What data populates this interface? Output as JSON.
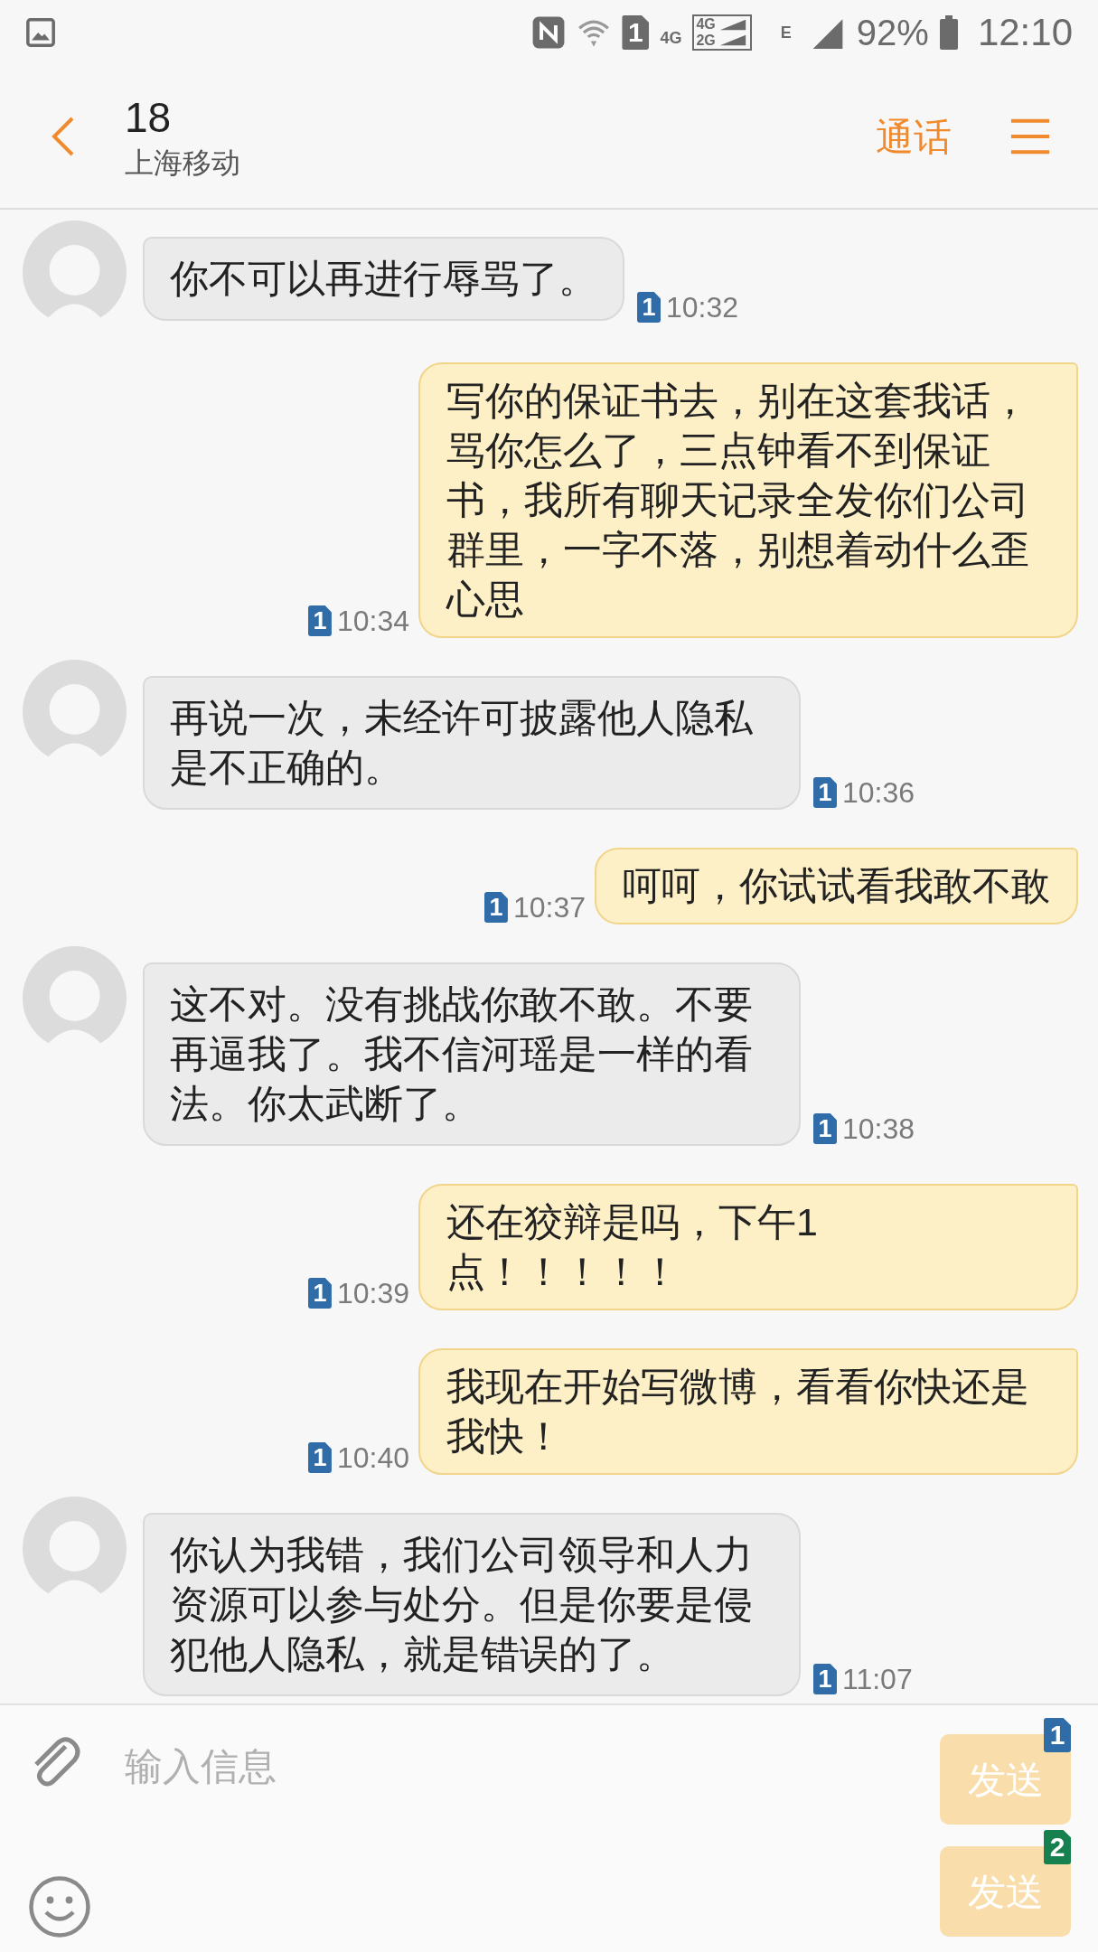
{
  "status_bar": {
    "sim": "1",
    "network": "4G",
    "dual_network": [
      "4G",
      "2G"
    ],
    "edge": "E",
    "battery": "92%",
    "time": "12:10"
  },
  "header": {
    "title": "18",
    "subtitle": "上海移动",
    "call_button": "通话"
  },
  "messages": [
    {
      "kind": "received",
      "text": "你不可以再进行辱骂了。",
      "sim": "1",
      "time": "10:32"
    },
    {
      "kind": "sent",
      "text": "写你的保证书去，别在这套我话，骂你怎么了，三点钟看不到保证书，我所有聊天记录全发你们公司群里，一字不落，别想着动什么歪心思",
      "sim": "1",
      "time": "10:34"
    },
    {
      "kind": "received",
      "text": "再说一次，未经许可披露他人隐私是不正确的。",
      "sim": "1",
      "time": "10:36"
    },
    {
      "kind": "sent",
      "text": "呵呵，你试试看我敢不敢",
      "sim": "1",
      "time": "10:37"
    },
    {
      "kind": "received",
      "text": "这不对。没有挑战你敢不敢。不要再逼我了。我不信河瑶是一样的看法。你太武断了。",
      "sim": "1",
      "time": "10:38"
    },
    {
      "kind": "sent",
      "text": "还在狡辩是吗，下午1点！！！！！",
      "sim": "1",
      "time": "10:39"
    },
    {
      "kind": "sent",
      "text": "我现在开始写微博，看看你快还是我快！",
      "sim": "1",
      "time": "10:40"
    },
    {
      "kind": "received",
      "text": "你认为我错，我们公司领导和人力资源可以参与处分。但是你要是侵犯他人隐私，就是错误的了。",
      "sim": "1",
      "time": "11:07"
    }
  ],
  "composer": {
    "placeholder": "输入信息",
    "send_buttons": [
      {
        "label": "发送",
        "sim": "1",
        "color": "#2f6ca8"
      },
      {
        "label": "发送",
        "sim": "2",
        "color": "#16804f"
      }
    ]
  }
}
